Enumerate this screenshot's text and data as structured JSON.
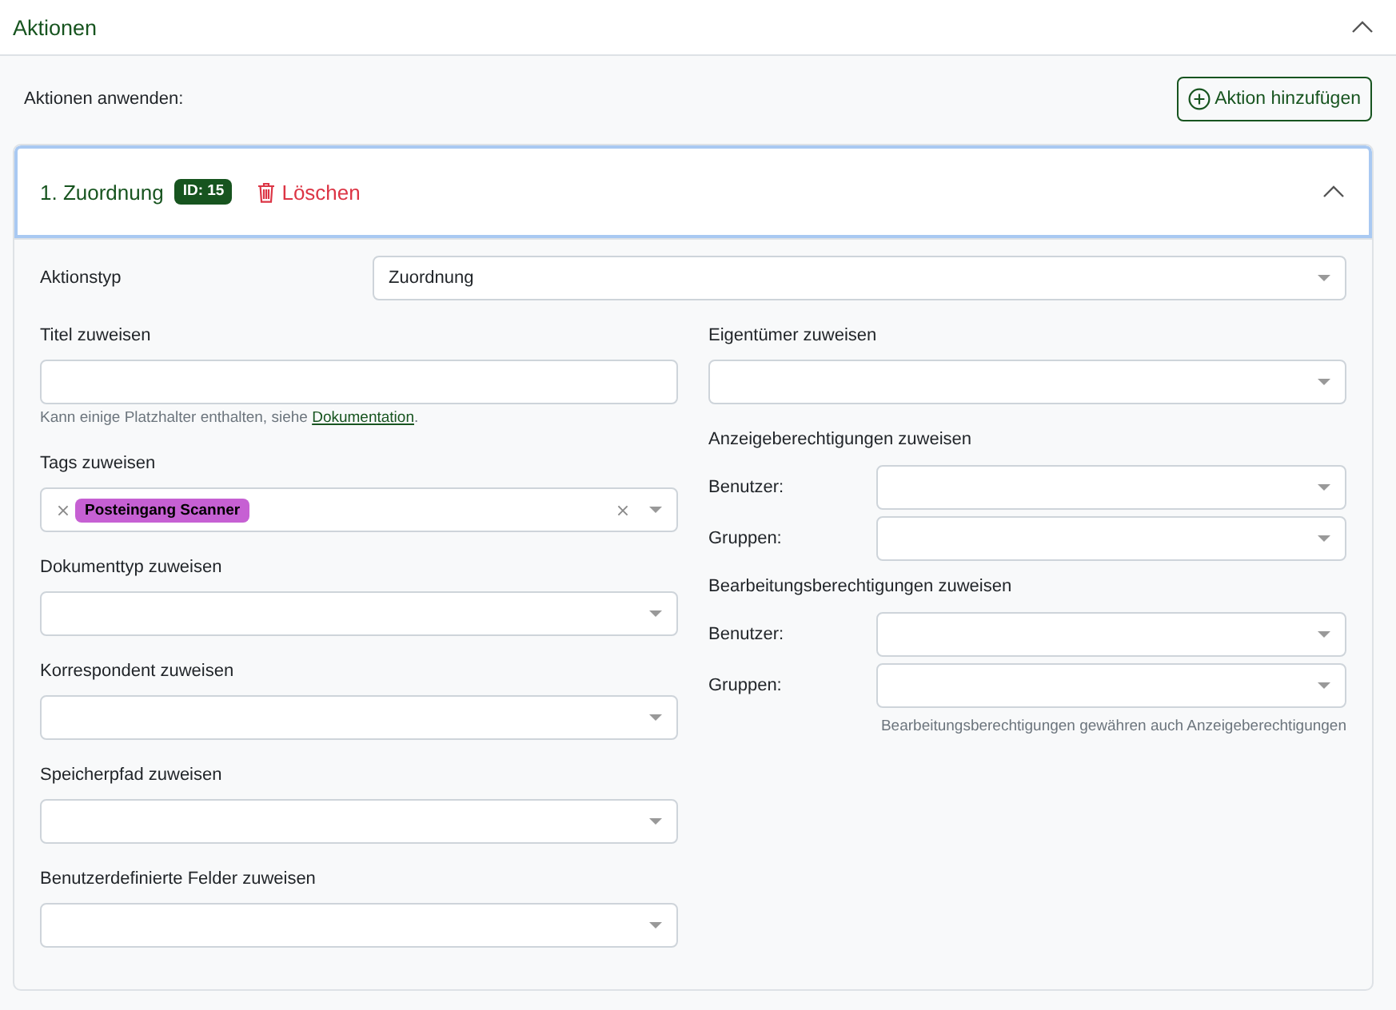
{
  "section": {
    "title": "Aktionen",
    "expanded": true
  },
  "toolbar": {
    "label": "Aktionen anwenden:",
    "add_button": "Aktion hinzufügen"
  },
  "actions": [
    {
      "title": "1. Zuordnung",
      "id_badge": "ID: 15",
      "delete_button": "Löschen",
      "expanded": true,
      "focused": true,
      "type_field": {
        "label": "Aktionstyp",
        "value": "Zuordnung"
      },
      "left_fields": [
        {
          "kind": "text",
          "label": "Titel zuweisen",
          "hint": {
            "text": "Kann einige Platzhalter enthalten, siehe ",
            "link": "Dokumentation",
            "after": "."
          }
        },
        {
          "kind": "tags",
          "label": "Tags zuweisen",
          "tags": [
            {
              "label": "Posteingang Scanner",
              "color": "#c660d3"
            }
          ]
        },
        {
          "kind": "select",
          "label": "Dokumenttyp zuweisen"
        },
        {
          "kind": "select",
          "label": "Korrespondent zuweisen"
        },
        {
          "kind": "select",
          "label": "Speicherpfad zuweisen"
        },
        {
          "kind": "select",
          "label": "Benutzerdefinierte Felder zuweisen"
        }
      ],
      "right_fields": [
        {
          "kind": "select",
          "label": "Eigentümer zuweisen"
        },
        {
          "kind": "permissions",
          "label": "Anzeigeberechtigungen zuweisen",
          "rows": [
            {
              "label": "Benutzer:"
            },
            {
              "label": "Gruppen:"
            }
          ]
        },
        {
          "kind": "permissions",
          "label": "Bearbeitungsberechtigungen zuweisen",
          "rows": [
            {
              "label": "Benutzer:"
            },
            {
              "label": "Gruppen:"
            }
          ],
          "note": "Bearbeitungsberechtigungen gewähren auch Anzeigeberechtigungen"
        }
      ]
    }
  ]
}
